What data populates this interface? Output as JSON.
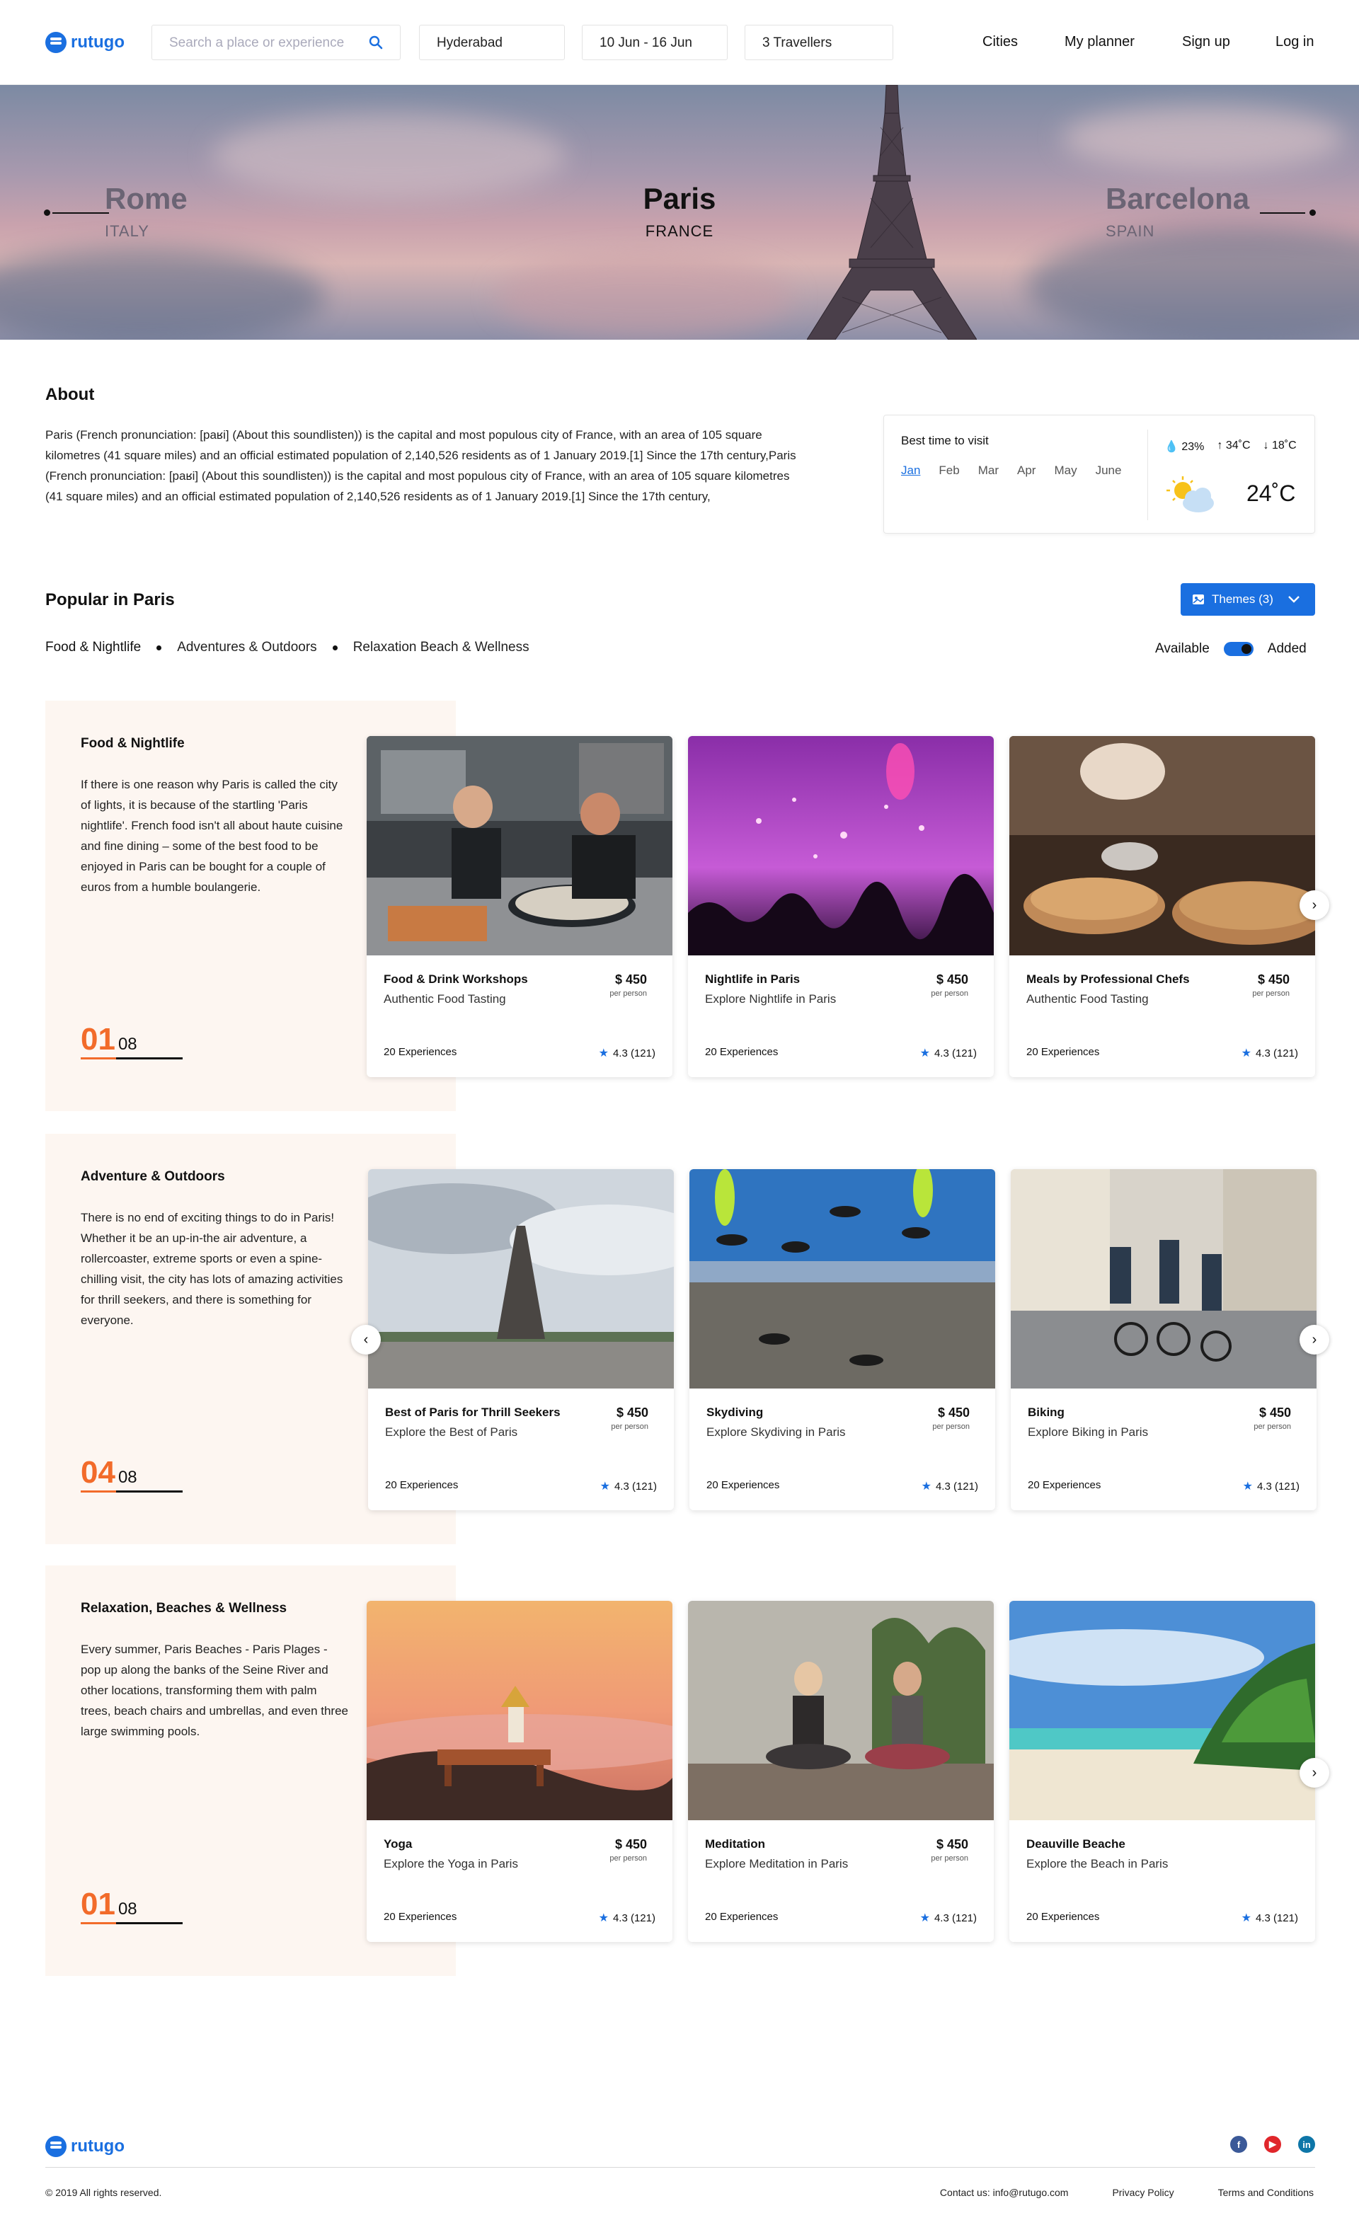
{
  "nav": {
    "logo": "rutugo",
    "search_placeholder": "Search a place or experience",
    "location": "Hyderabad",
    "dates": "10 Jun - 16 Jun",
    "travellers": "3 Travellers",
    "links": [
      "Cities",
      "My planner",
      "Sign up",
      "Log in"
    ]
  },
  "hero": {
    "prev": {
      "city": "Rome",
      "country": "ITALY"
    },
    "current": {
      "city": "Paris",
      "country": "FRANCE"
    },
    "next": {
      "city": "Barcelona",
      "country": "SPAIN"
    }
  },
  "about": {
    "heading": "About",
    "text": "Paris (French pronunciation: [paʁi] (About this soundlisten)) is the capital and most populous city of France, with an area of 105 square kilometres (41 square miles) and an official estimated population of 2,140,526 residents as of 1 January 2019.[1] Since the 17th century,Paris (French pronunciation: [paʁi] (About this soundlisten)) is the capital and most populous city of France, with an area of 105 square kilometres (41 square miles) and an official estimated population of 2,140,526 residents as of 1 January 2019.[1] Since the 17th century,"
  },
  "weather": {
    "label": "Best time to visit",
    "months": [
      "Jan",
      "Feb",
      "Mar",
      "Apr",
      "May",
      "June"
    ],
    "active_month": "Jan",
    "humidity": "23%",
    "high": "34˚C",
    "low": "18˚C",
    "temp": "24˚C"
  },
  "popular": {
    "heading": "Popular in Paris",
    "themes_button": "Themes (3)",
    "tabs": [
      "Food & Nightlife",
      "Adventures & Outdoors",
      "Relaxation Beach & Wellness"
    ],
    "toggle_left": "Available",
    "toggle_right": "Added"
  },
  "sections": [
    {
      "title": "Food & Nightlife",
      "desc": "If there is one reason why Paris is called the city of lights, it is because of the startling 'Paris nightlife'. French food isn't all about haute cuisine and fine dining – some of the best food to be enjoyed in Paris can be bought for a couple of euros from a humble boulangerie.",
      "counter_current": "01",
      "counter_total": "08",
      "cards": [
        {
          "title": "Food & Drink Workshops",
          "subtitle": "Authentic Food Tasting",
          "price": "$ 450",
          "per": "per person",
          "experiences": "20 Experiences",
          "rating": "4.3 (121)"
        },
        {
          "title": "Nightlife in Paris",
          "subtitle": "Explore Nightlife in Paris",
          "price": "$ 450",
          "per": "per person",
          "experiences": "20 Experiences",
          "rating": "4.3 (121)"
        },
        {
          "title": "Meals by Professional Chefs",
          "subtitle": "Authentic Food Tasting",
          "price": "$ 450",
          "per": "per person",
          "experiences": "20 Experiences",
          "rating": "4.3 (121)"
        }
      ]
    },
    {
      "title": "Adventure & Outdoors",
      "desc": "There is no end of exciting things to do in Paris! Whether it be an up-in-the air adventure, a rollercoaster, extreme sports or even a spine-chilling visit, the city has lots of amazing activities for thrill seekers, and there is something for everyone.",
      "counter_current": "04",
      "counter_total": "08",
      "cards": [
        {
          "title": "Best of Paris for Thrill Seekers",
          "subtitle": "Explore the Best of Paris",
          "price": "$ 450",
          "per": "per person",
          "experiences": "20 Experiences",
          "rating": "4.3 (121)"
        },
        {
          "title": "Skydiving",
          "subtitle": "Explore Skydiving in Paris",
          "price": "$ 450",
          "per": "per person",
          "experiences": "20 Experiences",
          "rating": "4.3 (121)"
        },
        {
          "title": "Biking",
          "subtitle": "Explore Biking in Paris",
          "price": "$ 450",
          "per": "per person",
          "experiences": "20 Experiences",
          "rating": "4.3 (121)"
        }
      ]
    },
    {
      "title": "Relaxation, Beaches & Wellness",
      "desc": "Every summer, Paris Beaches - Paris Plages - pop up along the banks of the Seine River and other locations, transforming them with palm trees, beach chairs and umbrellas, and even three large swimming pools.",
      "counter_current": "01",
      "counter_total": "08",
      "cards": [
        {
          "title": "Yoga",
          "subtitle": "Explore the Yoga in Paris",
          "price": "$ 450",
          "per": "per person",
          "experiences": "20 Experiences",
          "rating": "4.3 (121)"
        },
        {
          "title": "Meditation",
          "subtitle": "Explore Meditation in Paris",
          "price": "$ 450",
          "per": "per person",
          "experiences": "20 Experiences",
          "rating": "4.3 (121)"
        },
        {
          "title": "Deauville Beache",
          "subtitle": "Explore the Beach in Paris",
          "price": "",
          "per": "",
          "experiences": "20 Experiences",
          "rating": "4.3 (121)"
        }
      ]
    }
  ],
  "footer": {
    "logo": "rutugo",
    "copyright": "© 2019 All rights reserved.",
    "links": [
      "Contact us: info@rutugo.com",
      "Privacy Policy",
      "Terms and Conditions"
    ],
    "social": [
      "facebook-icon",
      "youtube-icon",
      "linkedin-icon"
    ]
  },
  "colors": {
    "accent": "#1a6fe0",
    "counter": "#f26b2a",
    "section_bg": "#fdf6f1"
  }
}
